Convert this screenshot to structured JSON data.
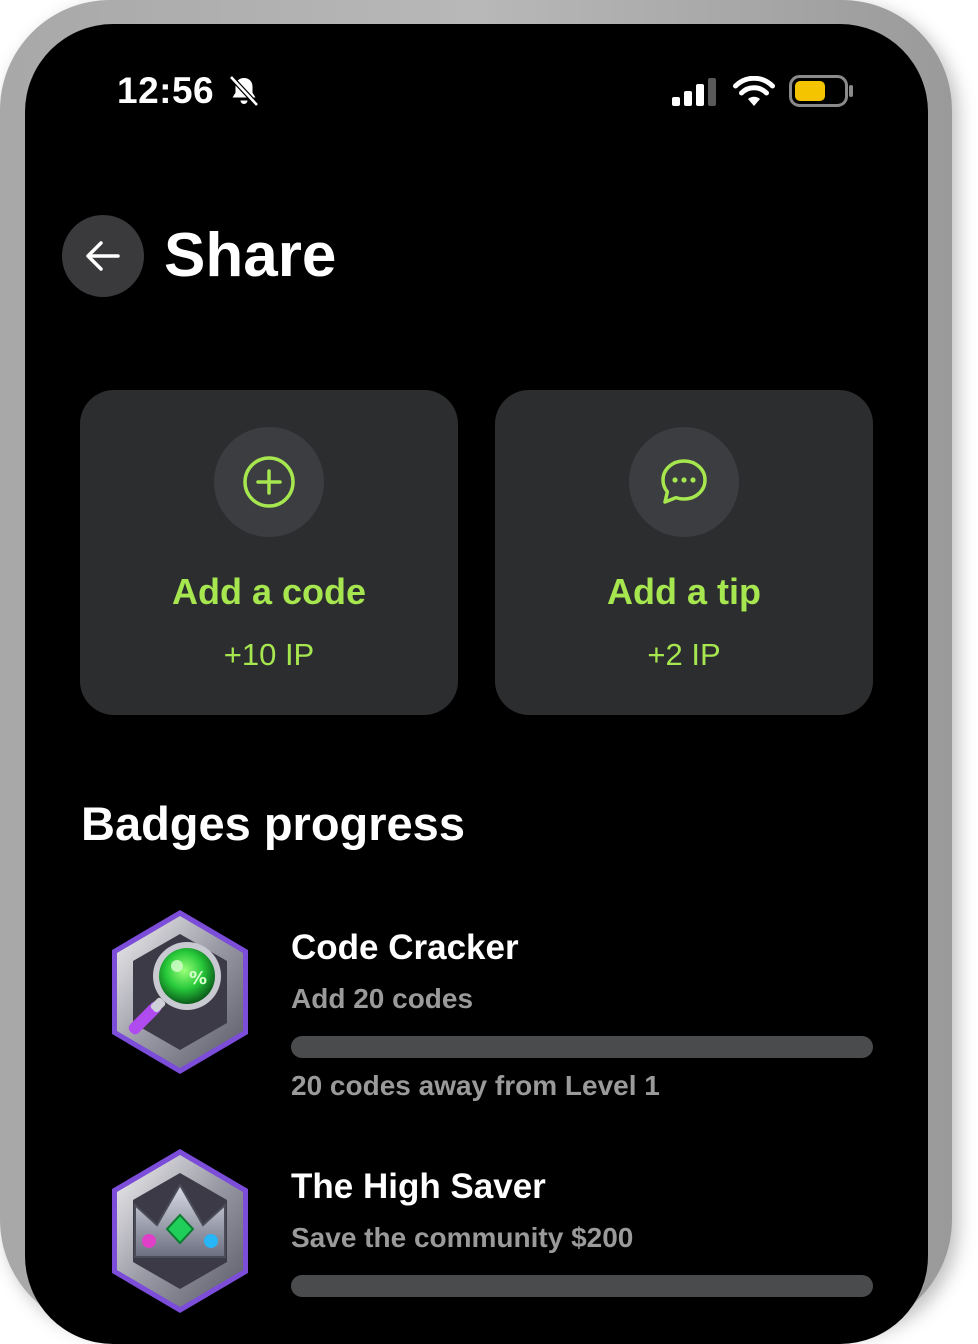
{
  "status_bar": {
    "time": "12:56",
    "icons": [
      "bell-slash-icon",
      "cellular-signal-icon",
      "wifi-icon",
      "battery-icon"
    ],
    "battery_color": "#f5c400"
  },
  "header": {
    "back_icon": "arrow-left-icon",
    "title": "Share"
  },
  "actions": [
    {
      "icon": "plus-circle-icon",
      "label": "Add a code",
      "points": "+10 IP"
    },
    {
      "icon": "chat-bubble-icon",
      "label": "Add a tip",
      "points": "+2 IP"
    }
  ],
  "badges": {
    "title": "Badges progress",
    "items": [
      {
        "icon": "magnifier-badge-icon",
        "name": "Code Cracker",
        "description": "Add 20 codes",
        "progress": 0,
        "hint": "20 codes away from Level 1"
      },
      {
        "icon": "crown-badge-icon",
        "name": "The High Saver",
        "description": "Save the community $200",
        "progress": 0,
        "hint": ""
      }
    ]
  },
  "colors": {
    "accent": "#a6e64f",
    "background": "#000000",
    "card": "#2c2d2f",
    "muted_text": "#9a9a9a"
  }
}
